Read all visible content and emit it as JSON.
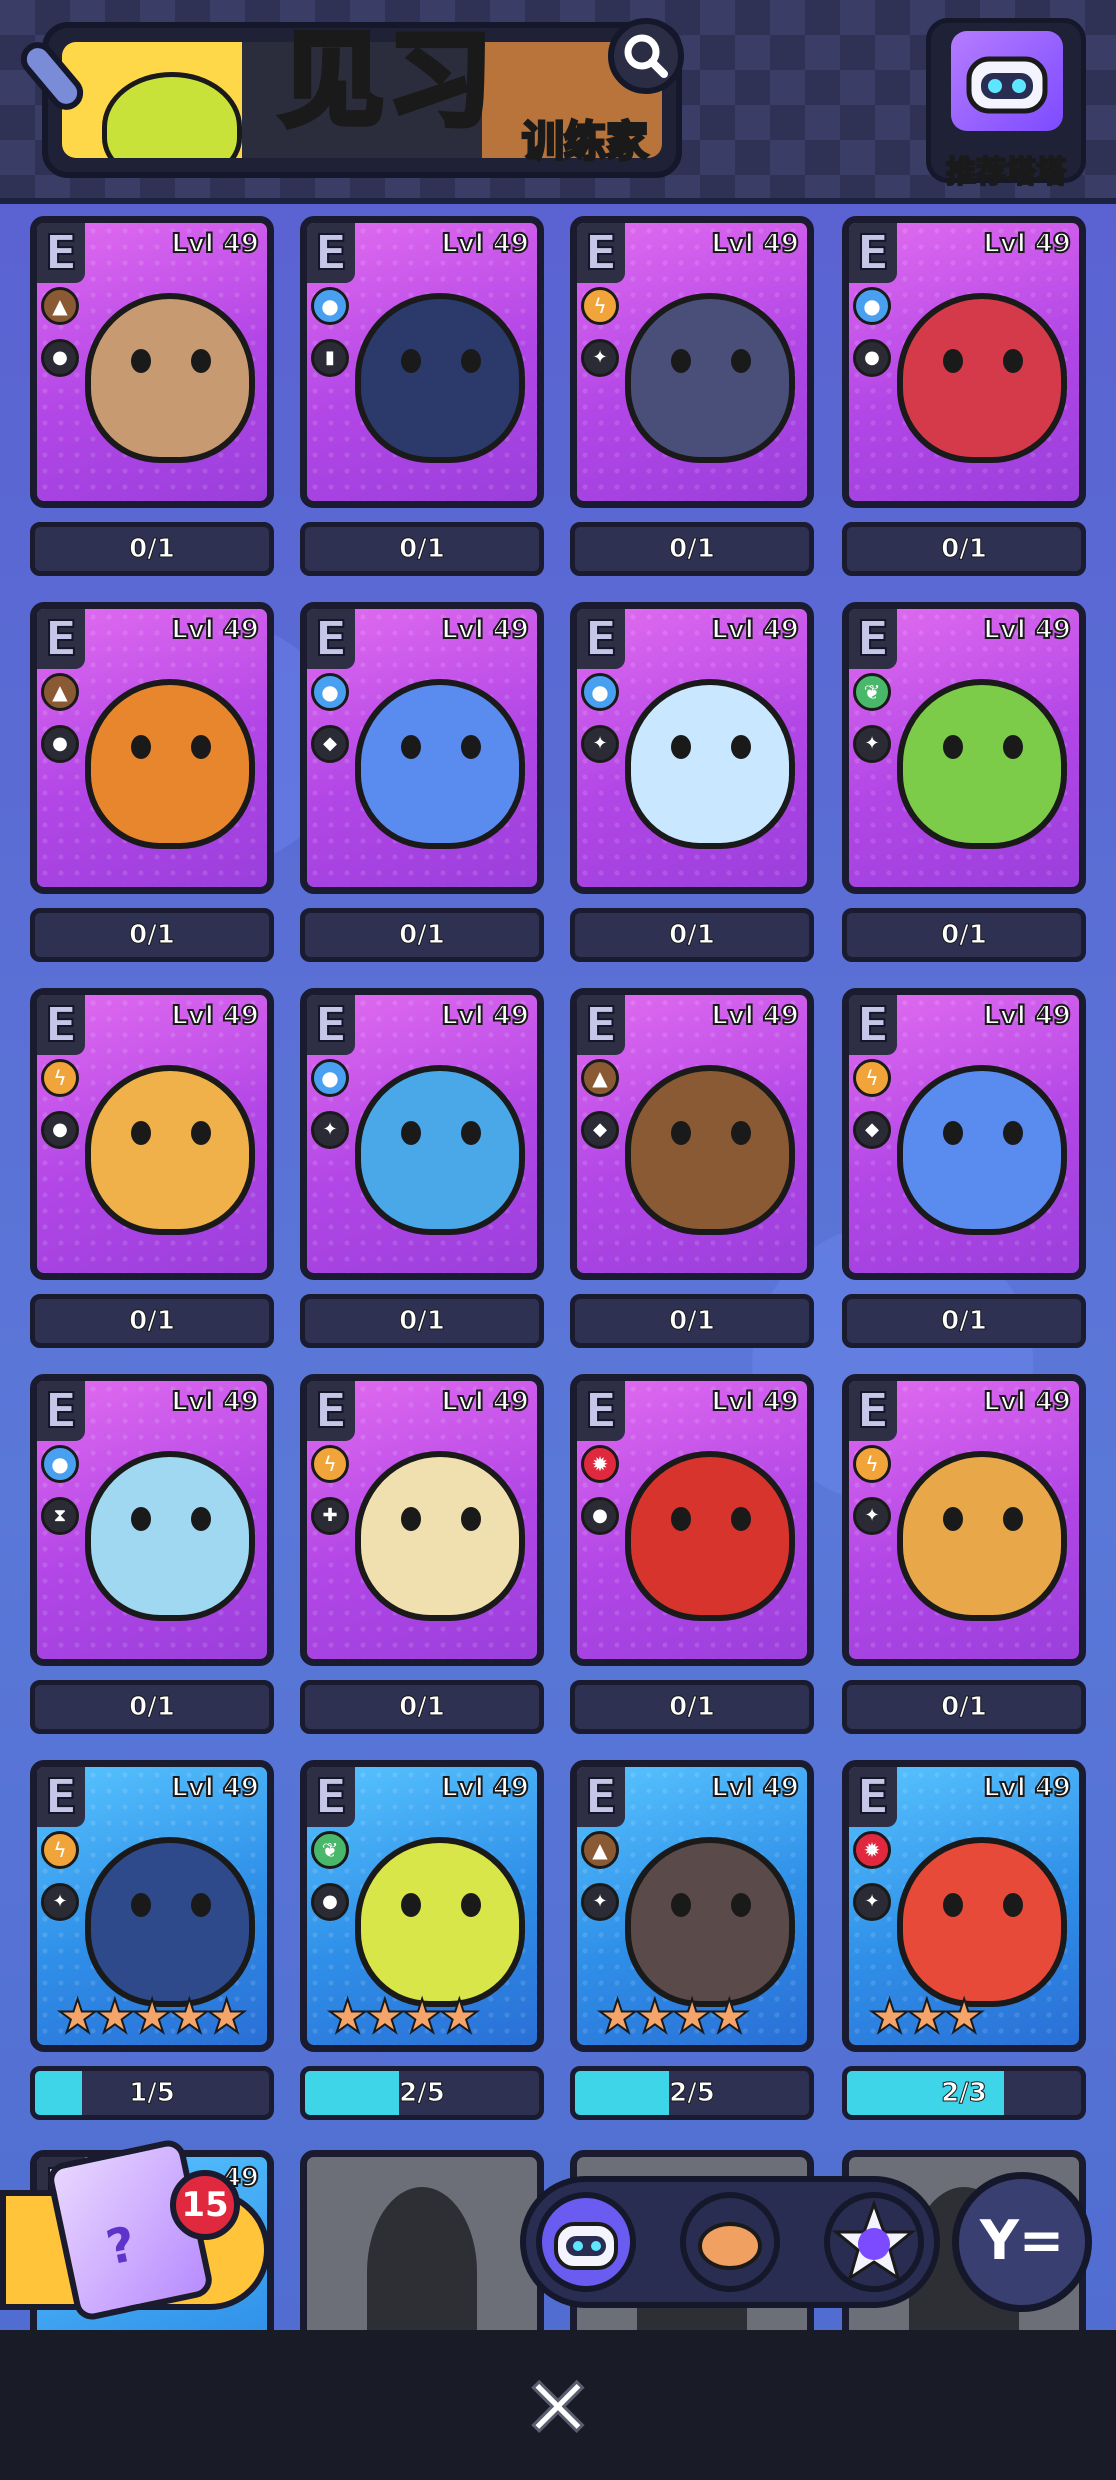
{
  "header": {
    "title": "见习",
    "subtitle": "训练家",
    "recommend_label": "推荐塔塔"
  },
  "colors": {
    "accent_cyan": "#3ed5e8",
    "card_purple": "#b246e6",
    "card_blue": "#2f8fe8",
    "badge_red": "#e0283e"
  },
  "cards": [
    {
      "rank": "E",
      "level": "Lvl 49",
      "element": "earth",
      "role": "tank",
      "count": "0/1",
      "bg": "purple",
      "color": "#c89a72"
    },
    {
      "rank": "E",
      "level": "Lvl 49",
      "element": "water",
      "role": "shield",
      "count": "0/1",
      "bg": "purple",
      "color": "#2b3a6a"
    },
    {
      "rank": "E",
      "level": "Lvl 49",
      "element": "electric",
      "role": "attacker",
      "count": "0/1",
      "bg": "purple",
      "color": "#4a4f7a"
    },
    {
      "rank": "E",
      "level": "Lvl 49",
      "element": "water",
      "role": "tank",
      "count": "0/1",
      "bg": "purple",
      "color": "#d43a4a"
    },
    {
      "rank": "E",
      "level": "Lvl 49",
      "element": "earth",
      "role": "tank",
      "count": "0/1",
      "bg": "purple",
      "color": "#e8862e"
    },
    {
      "rank": "E",
      "level": "Lvl 49",
      "element": "water",
      "role": "support",
      "count": "0/1",
      "bg": "purple",
      "color": "#5a8cf0"
    },
    {
      "rank": "E",
      "level": "Lvl 49",
      "element": "water",
      "role": "attacker",
      "count": "0/1",
      "bg": "purple",
      "color": "#c9e8ff"
    },
    {
      "rank": "E",
      "level": "Lvl 49",
      "element": "grass",
      "role": "attacker",
      "count": "0/1",
      "bg": "purple",
      "color": "#7ccc4a"
    },
    {
      "rank": "E",
      "level": "Lvl 49",
      "element": "electric",
      "role": "tank",
      "count": "0/1",
      "bg": "purple",
      "color": "#f0b14a"
    },
    {
      "rank": "E",
      "level": "Lvl 49",
      "element": "water",
      "role": "attacker",
      "count": "0/1",
      "bg": "purple",
      "color": "#4aa8e8"
    },
    {
      "rank": "E",
      "level": "Lvl 49",
      "element": "earth",
      "role": "support",
      "count": "0/1",
      "bg": "purple",
      "color": "#8a5a34"
    },
    {
      "rank": "E",
      "level": "Lvl 49",
      "element": "electric",
      "role": "support",
      "count": "0/1",
      "bg": "purple",
      "color": "#5a8cf0"
    },
    {
      "rank": "E",
      "level": "Lvl 49",
      "element": "water",
      "role": "special",
      "count": "0/1",
      "bg": "purple",
      "color": "#9fd8f0"
    },
    {
      "rank": "E",
      "level": "Lvl 49",
      "element": "electric",
      "role": "healer",
      "count": "0/1",
      "bg": "purple",
      "color": "#f0e0b0"
    },
    {
      "rank": "E",
      "level": "Lvl 49",
      "element": "fire",
      "role": "tank",
      "count": "0/1",
      "bg": "purple",
      "color": "#d8342e"
    },
    {
      "rank": "E",
      "level": "Lvl 49",
      "element": "electric",
      "role": "attacker",
      "count": "0/1",
      "bg": "purple",
      "color": "#e8a84a"
    },
    {
      "rank": "E",
      "level": "Lvl 49",
      "element": "electric",
      "role": "attacker",
      "count": "1/5",
      "progress": 0.2,
      "stars": 5,
      "bg": "blue",
      "color": "#2e4a8a"
    },
    {
      "rank": "E",
      "level": "Lvl 49",
      "element": "grass",
      "role": "tank",
      "count": "2/5",
      "progress": 0.4,
      "stars": 4,
      "bg": "blue",
      "color": "#d8e64a"
    },
    {
      "rank": "E",
      "level": "Lvl 49",
      "element": "earth",
      "role": "attacker",
      "count": "2/5",
      "progress": 0.4,
      "stars": 4,
      "bg": "blue",
      "color": "#5a4a4a"
    },
    {
      "rank": "E",
      "level": "Lvl 49",
      "element": "fire",
      "role": "attacker",
      "count": "2/3",
      "progress": 0.67,
      "stars": 3,
      "bg": "blue",
      "color": "#e84a3a"
    }
  ],
  "partial_row": {
    "level": "49",
    "locked_marks": [
      "?",
      "?",
      "?"
    ]
  },
  "mystery": {
    "count": "15",
    "icon": "?"
  },
  "dock": {
    "tabs": [
      "robot-cat-tab",
      "hamster-tab",
      "star-cat-tab"
    ],
    "filter_icon": "Y="
  },
  "footer": {
    "close_icon": "✕"
  }
}
